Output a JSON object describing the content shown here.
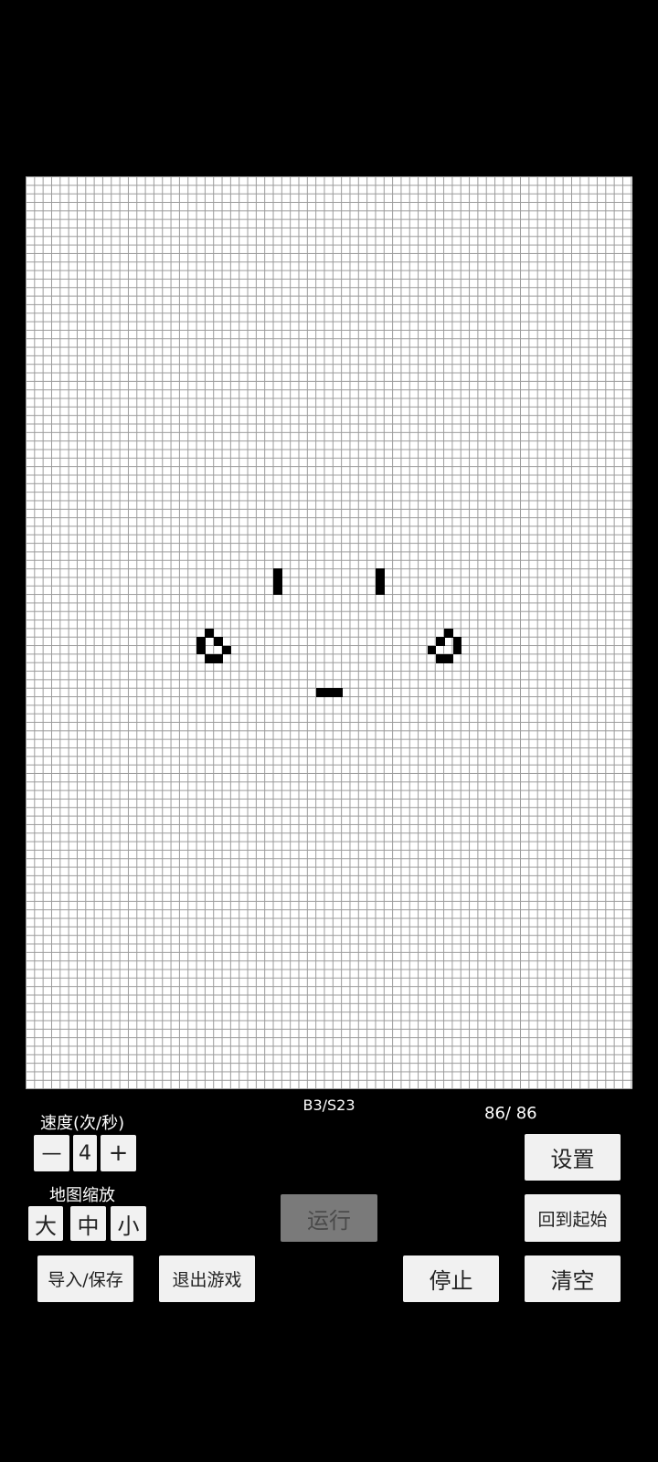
{
  "rule": "B3/S23",
  "population": "86/ 86",
  "speed": {
    "label": "速度(次/秒)",
    "minus": "—",
    "value": "4",
    "plus": "+"
  },
  "zoom": {
    "label": "地图缩放",
    "large": "大",
    "medium": "中",
    "small": "小"
  },
  "buttons": {
    "settings": "设置",
    "run": "运行",
    "back_to_start": "回到起始",
    "import_save": "导入/保存",
    "exit_game": "退出游戏",
    "stop": "停止",
    "clear": "清空"
  },
  "grid": {
    "cols": 71,
    "rows": 107,
    "live_cells": [
      [
        29,
        46
      ],
      [
        29,
        47
      ],
      [
        29,
        48
      ],
      [
        41,
        46
      ],
      [
        41,
        47
      ],
      [
        41,
        48
      ],
      [
        21,
        53
      ],
      [
        20,
        54
      ],
      [
        22,
        54
      ],
      [
        20,
        55
      ],
      [
        23,
        55
      ],
      [
        21,
        56
      ],
      [
        22,
        56
      ],
      [
        49,
        53
      ],
      [
        48,
        54
      ],
      [
        50,
        54
      ],
      [
        47,
        55
      ],
      [
        50,
        55
      ],
      [
        48,
        56
      ],
      [
        49,
        56
      ],
      [
        34,
        60
      ],
      [
        35,
        60
      ],
      [
        36,
        60
      ]
    ]
  }
}
